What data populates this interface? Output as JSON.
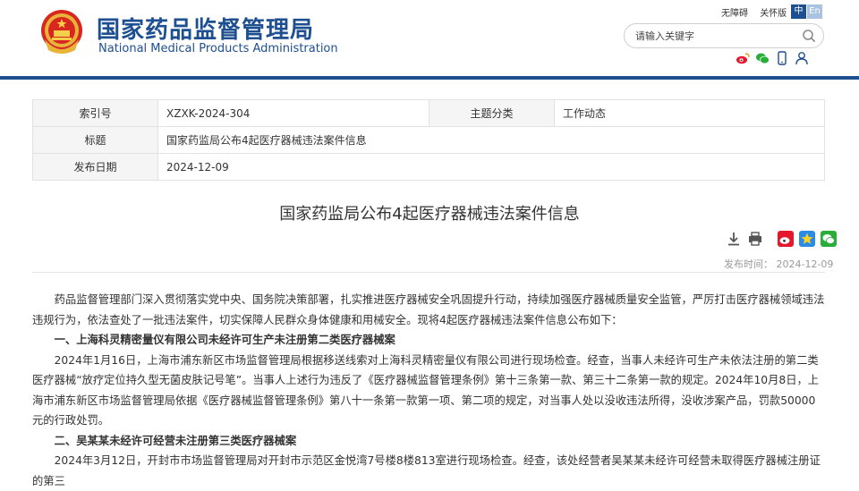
{
  "header": {
    "site_name_cn": "国家药品监督管理局",
    "site_name_en": "National Medical Products Administration",
    "top_links": [
      "无障碍",
      "关怀版"
    ],
    "lang_zh": "中",
    "lang_en": "En",
    "search_placeholder": "请输入关键字",
    "brand_color": "#1d4f91"
  },
  "info": {
    "index_label": "索引号",
    "index_value": "XZXK-2024-304",
    "category_label": "主题分类",
    "category_value": "工作动态",
    "title_label": "标题",
    "title_value": "国家药监局公布4起医疗器械违法案件信息",
    "date_label": "发布日期",
    "date_value": "2024-12-09"
  },
  "article": {
    "title": "国家药监局公布4起医疗器械违法案件信息",
    "pub_time": "发布时间：  2024-12-09",
    "paragraphs": [
      "药品监督管理部门深入贯彻落实党中央、国务院决策部署，扎实推进医疗器械安全巩固提升行动，持续加强医疗器械质量安全监管，严厉打击医疗器械领域违法违规行为，依法查处了一批违法案件，切实保障人民群众身体健康和用械安全。现将4起医疗器械违法案件信息公布如下：",
      "一、上海科灵精密量仪有限公司未经许可生产未注册第二类医疗器械案",
      "2024年1月16日，上海市浦东新区市场监督管理局根据移送线索对上海科灵精密量仪有限公司进行现场检查。经查，当事人未经许可生产未依法注册的第二类医疗器械“放疗定位持久型无菌皮肤记号笔”。当事人上述行为违反了《医疗器械监督管理条例》第十三条第一款、第三十二条第一款的规定。2024年10月8日，上海市浦东新区市场监督管理局依据《医疗器械监督管理条例》第八十一条第一款第一项、第二项的规定，对当事人处以没收违法所得，没收涉案产品，罚款50000元的行政处罚。",
      "二、吴某某未经许可经营未注册第三类医疗器械案",
      "2024年3月12日，开封市市场监督管理局对开封市示范区金悦湾7号楼8楼813室进行现场检查。经查，该处经营者吴某某未经许可经营未取得医疗器械注册证的第三"
    ]
  }
}
